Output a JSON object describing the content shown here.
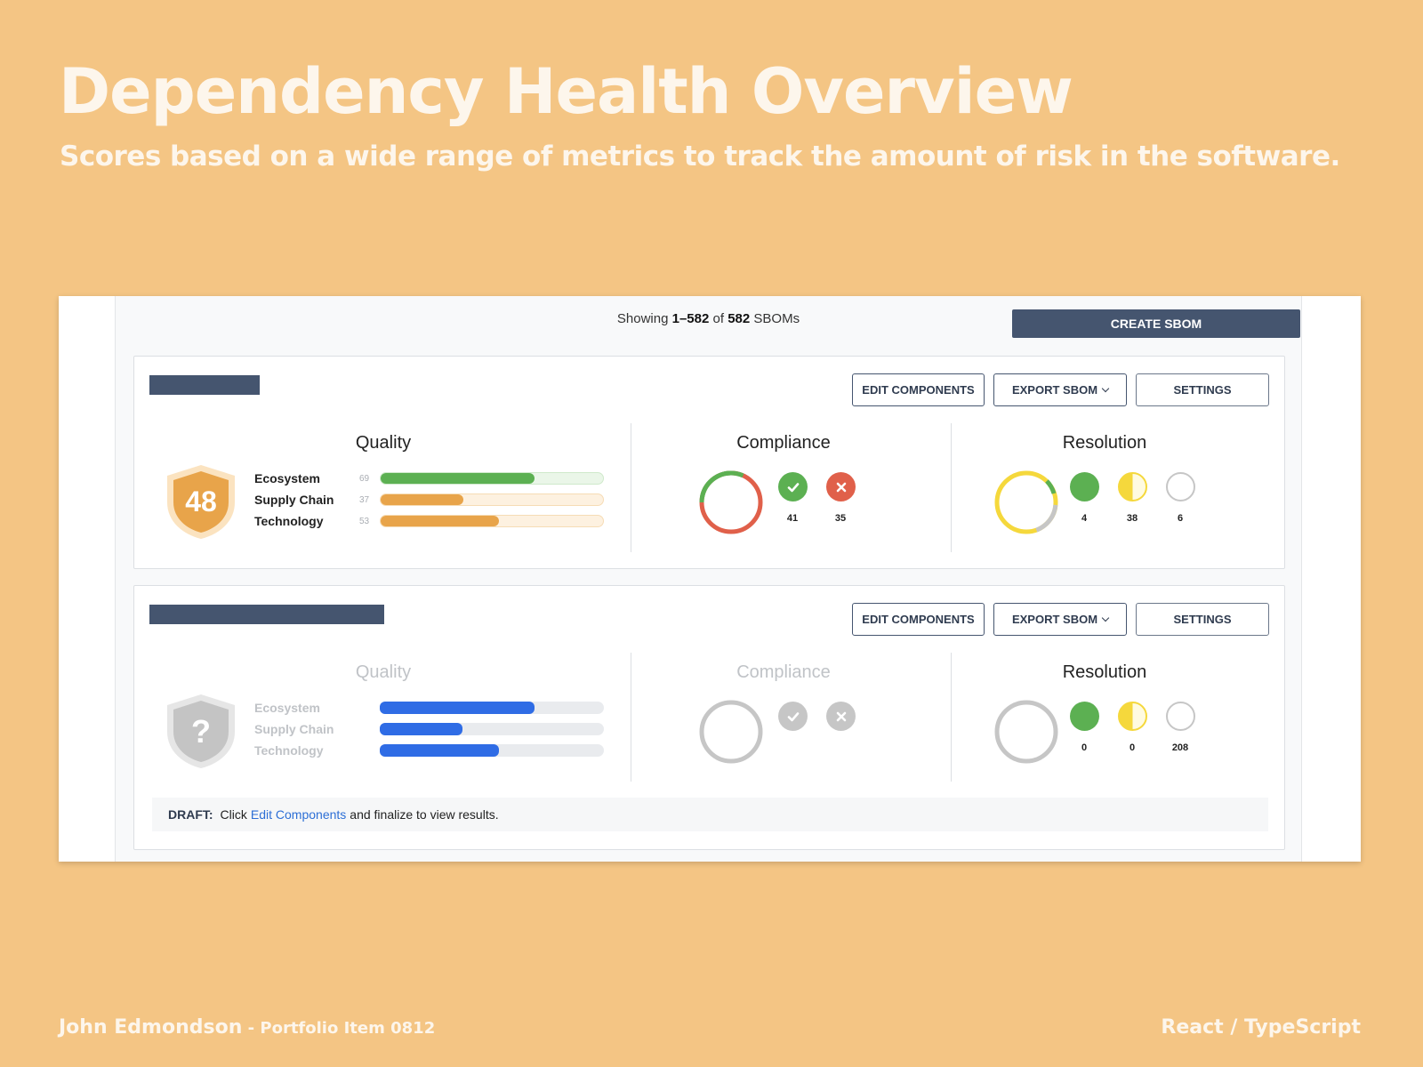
{
  "page": {
    "headline": "Dependency Health Overview",
    "subline": "Scores based on a wide range of metrics to track the amount of risk in the software.",
    "author": "John Edmondson",
    "author_suffix": " - Portfolio Item 0812",
    "tech": "React / TypeScript"
  },
  "toolbar": {
    "showing_prefix": "Showing ",
    "showing_range": "1–582",
    "showing_of": " of ",
    "showing_total": "582",
    "showing_suffix": " SBOMs",
    "create_label": "CREATE SBOM"
  },
  "card_actions": {
    "edit_label": "EDIT COMPONENTS",
    "export_label": "EXPORT SBOM",
    "settings_label": "SETTINGS"
  },
  "sections": {
    "quality": "Quality",
    "compliance": "Compliance",
    "resolution": "Resolution"
  },
  "metric_labels": [
    "Ecosystem",
    "Supply Chain",
    "Technology"
  ],
  "cards": [
    {
      "score": "48",
      "metrics": [
        {
          "value": "69",
          "fraction": 0.69
        },
        {
          "value": "37",
          "fraction": 0.37
        },
        {
          "value": "53",
          "fraction": 0.53
        }
      ],
      "compliance": {
        "pass": "41",
        "fail": "35"
      },
      "resolution": {
        "resolved": "4",
        "partial": "38",
        "open": "6"
      }
    },
    {
      "score": "?",
      "metrics": [
        {
          "fraction": 0.69
        },
        {
          "fraction": 0.37
        },
        {
          "fraction": 0.53
        }
      ],
      "resolution": {
        "resolved": "0",
        "partial": "0",
        "open": "208"
      },
      "draft": {
        "label": "DRAFT:",
        "prefix": "Click",
        "link": "Edit Components",
        "suffix": "and finalize to view results."
      }
    }
  ],
  "colors": {
    "green": "#5cb052",
    "red": "#e0604a",
    "yellow": "#f5d83c",
    "orange": "#e8a44a",
    "blue": "#2f6ce5",
    "navy": "#45556f"
  }
}
